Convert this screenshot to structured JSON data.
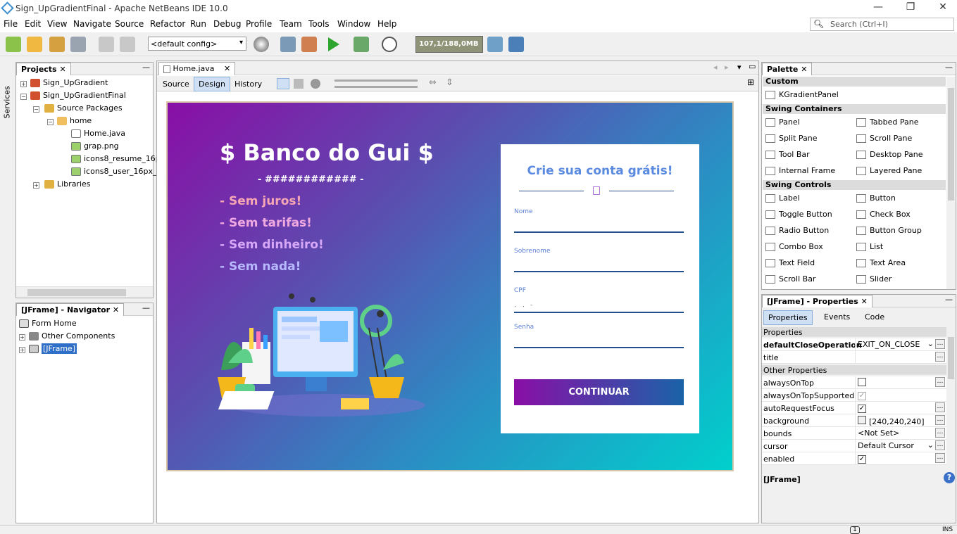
{
  "window": {
    "title": "Sign_UpGradientFinal - Apache NetBeans IDE 10.0",
    "min": "—",
    "restore": "❐",
    "close": "✕"
  },
  "menu": [
    "File",
    "Edit",
    "View",
    "Navigate",
    "Source",
    "Refactor",
    "Run",
    "Debug",
    "Profile",
    "Team",
    "Tools",
    "Window",
    "Help"
  ],
  "search": {
    "placeholder": "Search (Ctrl+I)"
  },
  "toolbar": {
    "config": "<default config>",
    "memory": "107,1/188,0MB"
  },
  "projects": {
    "tab": "Projects",
    "items": [
      "Sign_UpGradient",
      "Sign_UpGradientFinal",
      "Source Packages",
      "home",
      "Home.java",
      "grap.png",
      "icons8_resume_16p",
      "icons8_user_16px_",
      "Libraries"
    ]
  },
  "services": "Services",
  "navigator": {
    "tab": "[JFrame] - Navigator",
    "items": [
      "Form Home",
      "Other Components",
      "[JFrame]"
    ]
  },
  "editor": {
    "tab": "Home.java",
    "views": [
      "Source",
      "Design",
      "History"
    ]
  },
  "form": {
    "heading": "$ Banco do Gui $",
    "subheading": "- ############ -",
    "bullets": [
      "- Sem juros!",
      "- Sem tarifas!",
      "- Sem dinheiro!",
      "- Sem nada!"
    ],
    "card_title": "Crie sua conta grátis!",
    "fields": [
      "Nome",
      "Sobrenome",
      "CPF",
      "Senha"
    ],
    "cpf_mask": ". . -",
    "button": "CONTINUAR"
  },
  "palette": {
    "tab": "Palette",
    "sections": [
      {
        "name": "Custom",
        "items": [
          "KGradientPanel"
        ]
      },
      {
        "name": "Swing Containers",
        "items": [
          "Panel",
          "Tabbed Pane",
          "Split Pane",
          "Scroll Pane",
          "Tool Bar",
          "Desktop Pane",
          "Internal Frame",
          "Layered Pane"
        ]
      },
      {
        "name": "Swing Controls",
        "items": [
          "Label",
          "Button",
          "Toggle Button",
          "Check Box",
          "Radio Button",
          "Button Group",
          "Combo Box",
          "List",
          "Text Field",
          "Text Area",
          "Scroll Bar",
          "Slider"
        ]
      }
    ]
  },
  "properties": {
    "tab": "[JFrame] - Properties",
    "tabs": [
      "Properties",
      "Events",
      "Code"
    ],
    "group1": "Properties",
    "group2": "Other Properties",
    "rows": [
      {
        "k": "defaultCloseOperation",
        "v": "EXIT_ON_CLOSE"
      },
      {
        "k": "title",
        "v": ""
      },
      {
        "k": "alwaysOnTop",
        "v": ""
      },
      {
        "k": "alwaysOnTopSupported",
        "v": "✓"
      },
      {
        "k": "autoRequestFocus",
        "v": "✓"
      },
      {
        "k": "background",
        "v": "[240,240,240]"
      },
      {
        "k": "bounds",
        "v": "<Not Set>"
      },
      {
        "k": "cursor",
        "v": "Default Cursor"
      },
      {
        "k": "enabled",
        "v": "✓"
      }
    ],
    "footer": "[JFrame]"
  },
  "status": {
    "notifications": "1",
    "mode": "INS"
  }
}
